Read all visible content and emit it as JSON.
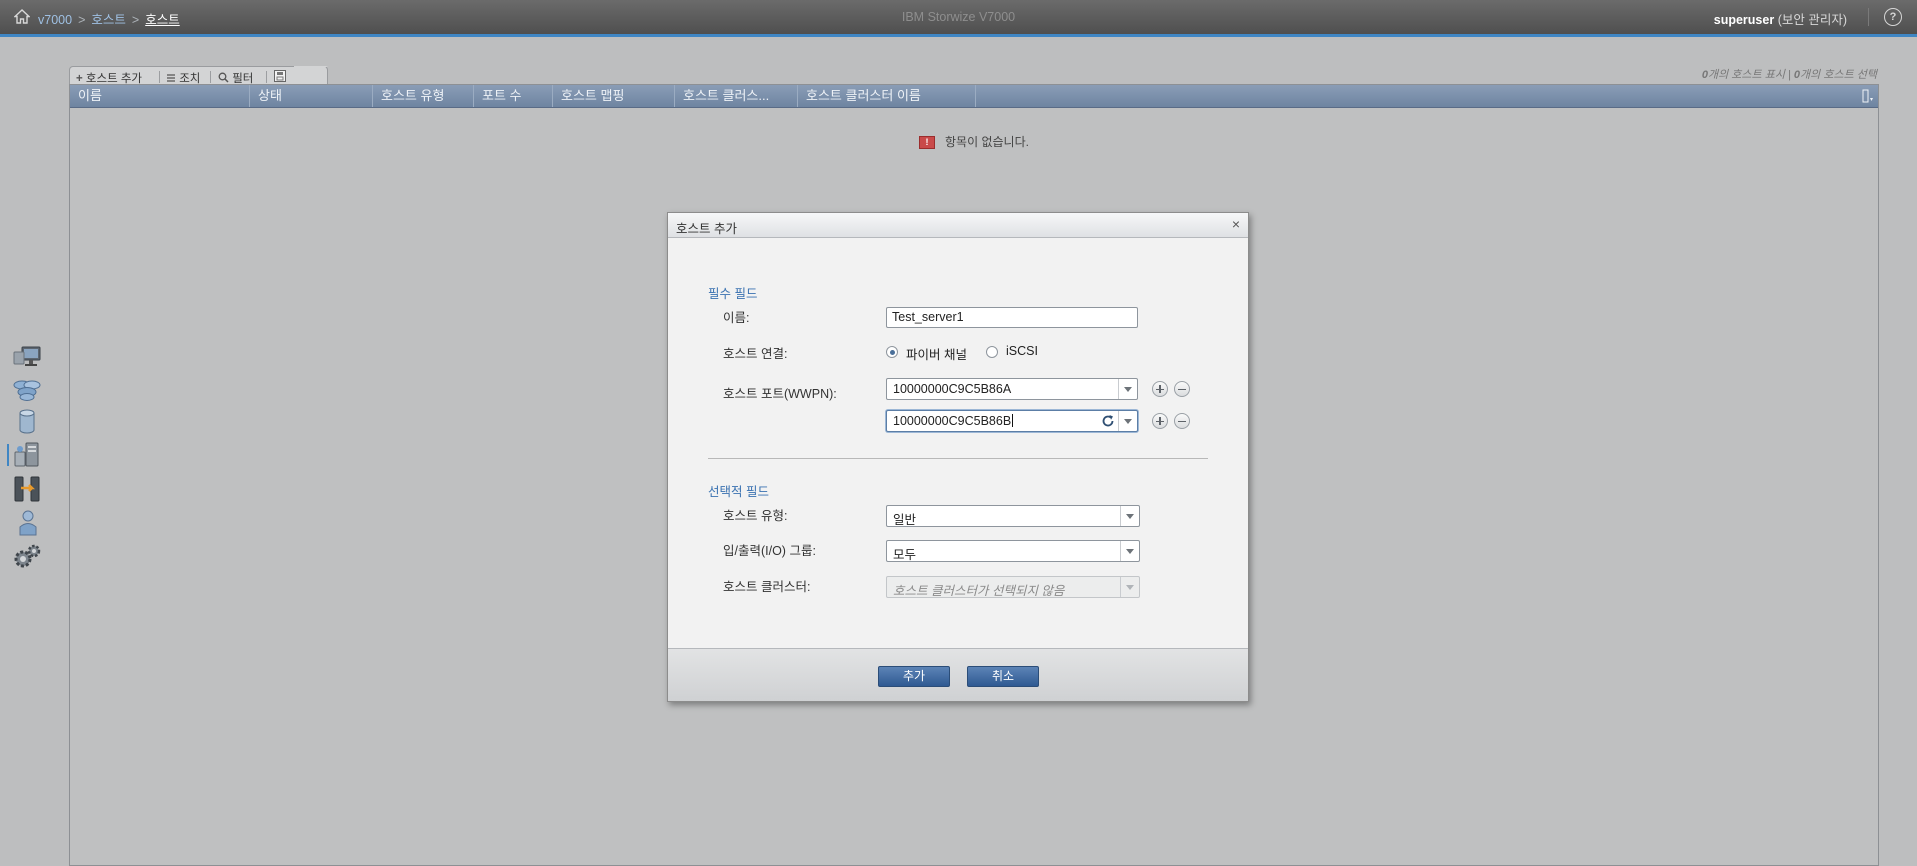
{
  "header": {
    "breadcrumb": {
      "root": "v7000",
      "sep1": ">",
      "section": "호스트",
      "sep2": ">",
      "current": "호스트"
    },
    "app_title": "IBM Storwize V7000",
    "user_name": "superuser",
    "user_role": "(보안 관리자)",
    "help_glyph": "?"
  },
  "nav": {
    "items": [
      "monitoring",
      "pools",
      "volumes",
      "hosts",
      "copy-services",
      "access",
      "settings"
    ],
    "active": "hosts"
  },
  "toolbar": {
    "add_host": "호스트 추가",
    "actions": "조치",
    "filter": "필터"
  },
  "table": {
    "count_text": {
      "shown_num": "0",
      "shown_label": "개의 호스트 표시",
      "sep": "|",
      "selected_num": "0",
      "selected_label": "개의 호스트 선택"
    },
    "columns": [
      "이름",
      "상태",
      "호스트 유형",
      "포트 수",
      "호스트 맵핑",
      "호스트 클러스...",
      "호스트 클러스터 이름"
    ],
    "empty_message": "항목이 없습니다.",
    "empty_glyph": "!"
  },
  "dialog": {
    "title": "호스트 추가",
    "close_glyph": "×",
    "required_title": "필수 필드",
    "name_label": "이름:",
    "name_value": "Test_server1",
    "connection_label": "호스트 연결:",
    "connection_options": [
      "파이버 채널",
      "iSCSI"
    ],
    "connection_selected": "파이버 채널",
    "ports_label": "호스트 포트(WWPN):",
    "ports": [
      "10000000C9C5B86A",
      "10000000C9C5B86B"
    ],
    "optional_title": "선택적 필드",
    "host_type_label": "호스트 유형:",
    "host_type_value": "일반",
    "io_group_label": "입/출력(I/O) 그룹:",
    "io_group_value": "모두",
    "cluster_label": "호스트 클러스터:",
    "cluster_placeholder": "호스트 클러스터가 선택되지 않음",
    "add_button": "추가",
    "cancel_button": "취소"
  }
}
